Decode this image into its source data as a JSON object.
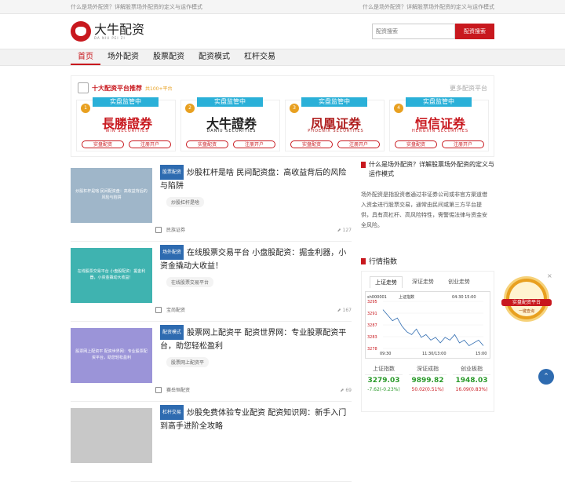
{
  "topbar": {
    "left": "什么是场外配资？详解股票场外配资的定义与运作模式",
    "right": "什么是场外配资？详解股票场外配资的定义与运作模式"
  },
  "logo": {
    "name": "大牛配资",
    "sub": "DA NIU PEI ZI"
  },
  "search": {
    "placeholder": "配资搜索",
    "button": "配资搜索"
  },
  "nav": [
    "首页",
    "场外配资",
    "股票配资",
    "配资模式",
    "杠杆交易"
  ],
  "platform": {
    "title": "十大配资平台推荐",
    "count": "共100+平台",
    "more": "更多配资平台",
    "cards": [
      {
        "tag": "实盘监管中",
        "num": "1",
        "name": "長勝證券",
        "eng": "WIN SECURITIES",
        "btn1": "实盘配资",
        "btn2": "注册开户",
        "color": "#c8181e"
      },
      {
        "tag": "实盘监管中",
        "num": "2",
        "name": "大牛證券",
        "eng": "DANIU SECURITIES",
        "btn1": "实盘配资",
        "btn2": "注册开户",
        "color": "#222"
      },
      {
        "tag": "实盘监管中",
        "num": "3",
        "name": "凤凰证券",
        "eng": "PHOENIX SECURITIES",
        "btn1": "实盘配资",
        "btn2": "注册开户",
        "color": "#b02020"
      },
      {
        "tag": "实盘监管中",
        "num": "4",
        "name": "恒信证券",
        "eng": "HENGXIN SECURITIES",
        "btn1": "实盘配资",
        "btn2": "注册开户",
        "color": "#c8181e"
      }
    ]
  },
  "articles": [
    {
      "cat": "股票配资",
      "title": "炒股杠杆是啥 民间配资盘：高收益背后的风险与陷阱",
      "thumb": "炒股杠杆是啥 民间配资盘：高收益背后的风险与陷阱",
      "kw": "炒股杠杆是啥",
      "src": "民族证券",
      "views": "127",
      "bg": "#9fb6c9"
    },
    {
      "cat": "场外配资",
      "title": "在线股票交易平台 小盘股配资：掘金利器，小资金撬动大收益！",
      "thumb": "在线股票交易平台 小盘股配资：掘金利器，小资金撬动大收益！",
      "kw": "在线股票交易平台",
      "src": "宝尚配资",
      "views": "167",
      "bg": "#3fb3b0"
    },
    {
      "cat": "配资模式",
      "title": "股票网上配资平 配资世界网：专业股票配资平台，助您轻松盈利",
      "thumb": "股票网上配资平 配资世界网：专业股票配资平台，助您轻松盈利",
      "kw": "股票网上配资平",
      "src": "赛岳恒配资",
      "views": "69",
      "bg": "#9b94d8"
    },
    {
      "cat": "杠杆交易",
      "title": "炒股免费体验专业配资 配资知识网：新手入门到高手进阶全攻略",
      "thumb": "",
      "kw": "",
      "src": "",
      "views": "",
      "bg": "#c8c8c8"
    }
  ],
  "sidebar": {
    "title": "什么是场外配资？详解股票场外配资的定义与运作模式",
    "text": "场外配资是指投资者通过非证券公司或非官方渠道借入资金进行股票交易，通常由民间或第三方平台提供，具有高杠杆、高风险特性，需警惕法律与资金安全风险。",
    "market_title": "行情指数",
    "tabs": [
      "上证走势",
      "深证走势",
      "创业走势"
    ],
    "chart": {
      "code": "sh000001",
      "name": "上证指数",
      "time": "04-30 15:00",
      "y": [
        "3295",
        "3291",
        "3287",
        "3283",
        "3278"
      ],
      "x": [
        "09:30",
        "11:30/13:00",
        "15:00"
      ]
    },
    "indices": [
      {
        "name": "上证指数",
        "value": "3279.03",
        "delta": "-7.62(-0.23%)"
      },
      {
        "name": "深证成指",
        "value": "9899.82",
        "delta": "50.02(0.51%)"
      },
      {
        "name": "创业板指",
        "value": "1948.03",
        "delta": "16.09(0.83%)"
      }
    ]
  },
  "chart_data": {
    "type": "line",
    "title": "上证指数",
    "x": [
      "09:30",
      "11:30/13:00",
      "15:00"
    ],
    "ylim": [
      3278,
      3295
    ],
    "series": [
      {
        "name": "上证指数",
        "values": [
          3292,
          3290,
          3288,
          3289,
          3286,
          3284,
          3283,
          3285,
          3282,
          3283,
          3281,
          3282,
          3280,
          3282,
          3281,
          3283,
          3280,
          3281,
          3279,
          3280,
          3281,
          3279
        ]
      }
    ]
  },
  "float": {
    "label": "实盘配资平台",
    "sub": "一键查询",
    "close": "×"
  },
  "up": "⌃"
}
